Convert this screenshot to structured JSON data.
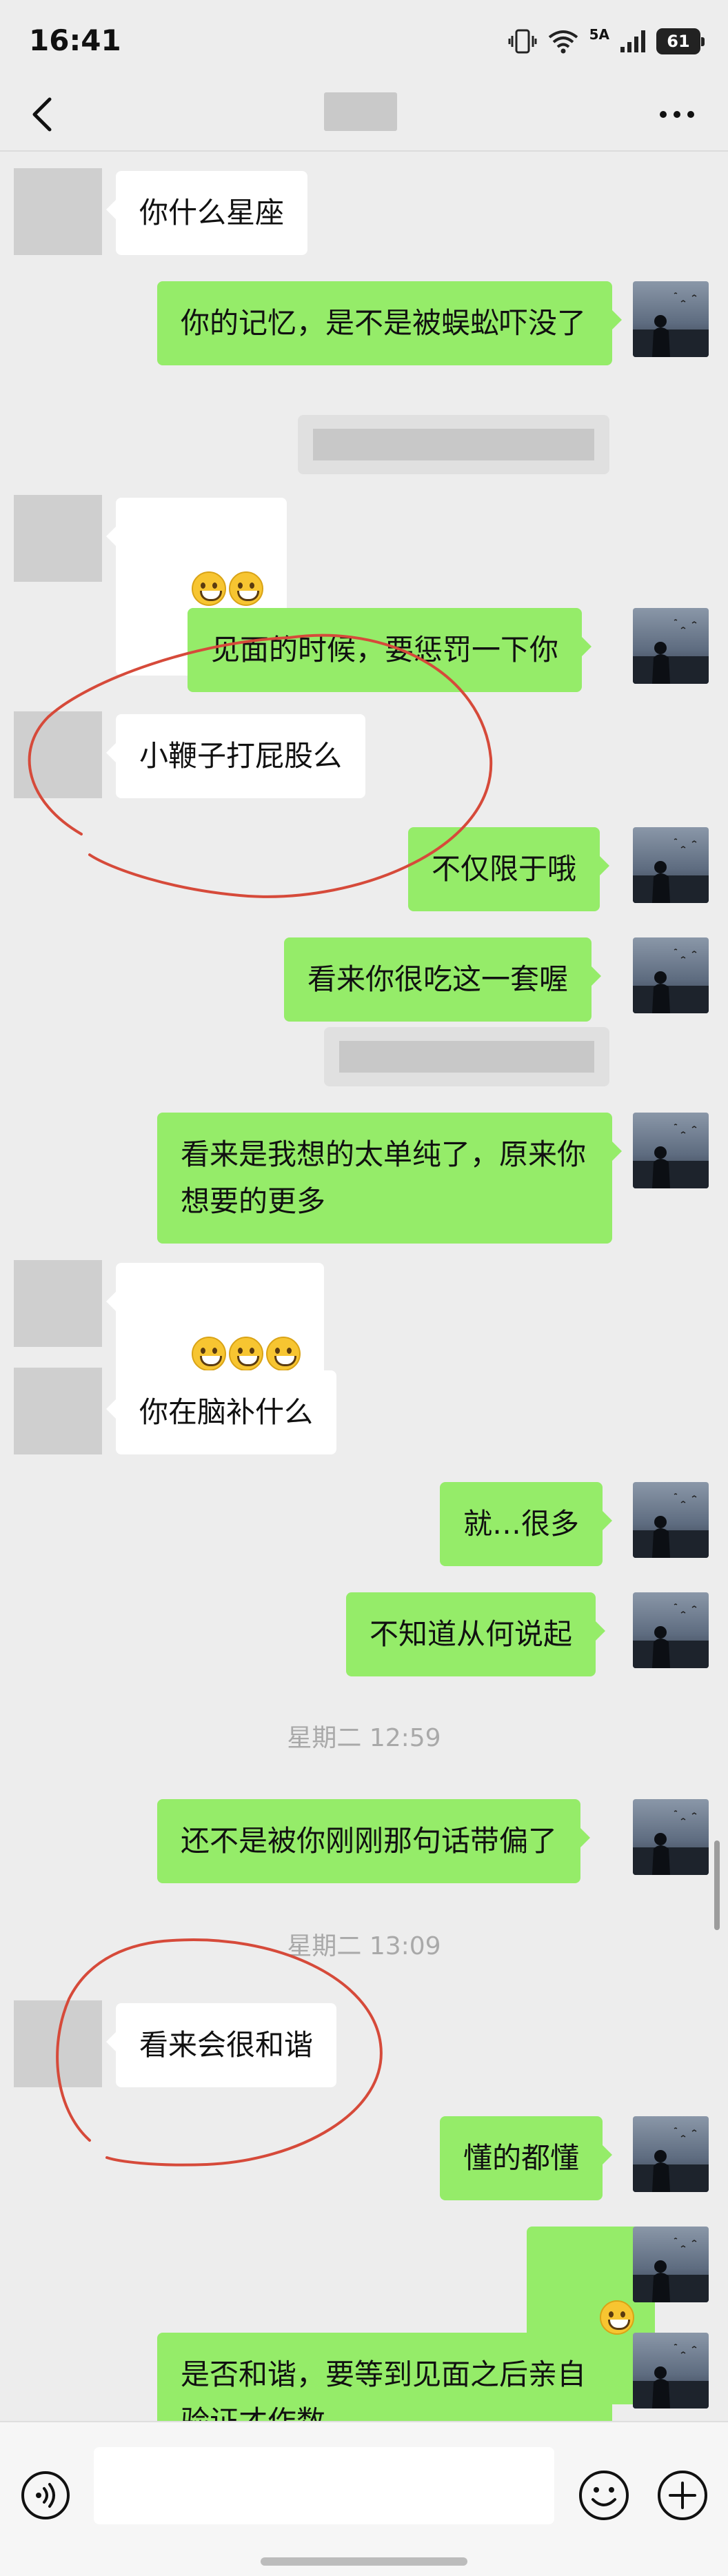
{
  "status_bar": {
    "time": "16:41",
    "network": "5A",
    "battery": "61"
  },
  "nav": {
    "title": "",
    "back_icon": "chevron-left-icon",
    "more_icon": "more-dots-icon"
  },
  "messages": [
    {
      "side": "in",
      "text": "你什么星座"
    },
    {
      "side": "out",
      "text": "你的记忆，是不是被蜈蚣吓没了"
    },
    {
      "side": "out-quote",
      "text": ""
    },
    {
      "side": "in",
      "emoji_count": 2,
      "emoji_name": "grin-emoji"
    },
    {
      "side": "out",
      "text": "见面的时候，要惩罚一下你"
    },
    {
      "side": "in",
      "text": "小鞭子打屁股么"
    },
    {
      "side": "out",
      "text": "不仅限于哦"
    },
    {
      "side": "out",
      "text": "看来你很吃这一套喔"
    },
    {
      "side": "out-quote",
      "text": ""
    },
    {
      "side": "out",
      "text": "看来是我想的太单纯了，原来你想要的更多"
    },
    {
      "side": "in",
      "emoji_count": 3,
      "emoji_name": "grin-emoji"
    },
    {
      "side": "in",
      "text": "你在脑补什么"
    },
    {
      "side": "out",
      "text": "就…很多"
    },
    {
      "side": "out",
      "text": "不知道从何说起"
    },
    {
      "side": "time",
      "text": "星期二 12:59"
    },
    {
      "side": "out",
      "text": "还不是被你刚刚那句话带偏了"
    },
    {
      "side": "time",
      "text": "星期二 13:09"
    },
    {
      "side": "in",
      "text": "看来会很和谐"
    },
    {
      "side": "out",
      "text": "懂的都懂"
    },
    {
      "side": "out",
      "emoji_count": 1,
      "emoji_name": "grin-emoji"
    },
    {
      "side": "out",
      "text": "是否和谐，要等到见面之后亲自验证才作数"
    }
  ],
  "input_bar": {
    "placeholder": "",
    "voice_icon": "voice-icon",
    "emoji_icon": "emoji-icon",
    "plus_icon": "plus-icon"
  },
  "colors": {
    "background": "#ededed",
    "outgoing_bubble": "#95ec69",
    "incoming_bubble": "#ffffff",
    "annotation_circle": "#d64a3a"
  }
}
